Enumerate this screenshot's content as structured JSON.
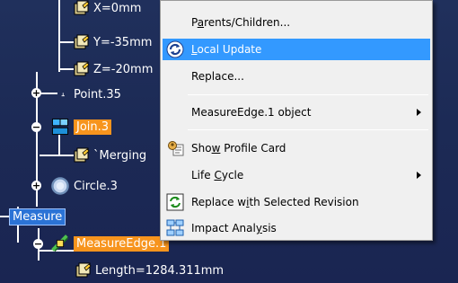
{
  "tree": {
    "nodes": [
      {
        "label": "X=0mm",
        "icon": "parameter-icon"
      },
      {
        "label": "Y=-35mm",
        "icon": "parameter-icon"
      },
      {
        "label": "Z=-20mm",
        "icon": "parameter-icon"
      },
      {
        "label": "Point.35",
        "icon": "point-icon"
      },
      {
        "label": "Join.3",
        "icon": "join-icon"
      },
      {
        "label": "`Merging",
        "icon": "parameter-icon"
      },
      {
        "label": "Circle.3",
        "icon": "circle-icon"
      },
      {
        "label": "Measure",
        "icon": ""
      },
      {
        "label": "MeasureEdge.1",
        "icon": "measure-edge-icon"
      },
      {
        "label": "Length=1284.311mm",
        "icon": "parameter-icon"
      }
    ]
  },
  "context_menu": {
    "items": [
      {
        "label": "Parents/Children...",
        "underline": "a",
        "icon": ""
      },
      {
        "label": "Local Update",
        "underline": "L",
        "icon": "update-icon",
        "active": true
      },
      {
        "label": "Replace...",
        "underline": "",
        "icon": ""
      },
      {
        "label": "MeasureEdge.1 object",
        "underline": "",
        "icon": "",
        "submenu": true
      },
      {
        "label": "Show Profile Card",
        "underline": "w",
        "icon": "profile-card-icon"
      },
      {
        "label": "Life Cycle",
        "underline": "C",
        "icon": "",
        "submenu": true
      },
      {
        "label": "Replace with Selected Revision",
        "underline": "i",
        "icon": "replace-revision-icon"
      },
      {
        "label": "Impact Analysis",
        "underline": "y",
        "icon": "impact-analysis-icon"
      }
    ]
  },
  "colors": {
    "tree_background": "#1c2a55",
    "highlight_orange": "#f7941d",
    "highlight_blue": "#2b73d6",
    "menu_background": "#f0f0f0",
    "menu_active": "#3399ff"
  }
}
